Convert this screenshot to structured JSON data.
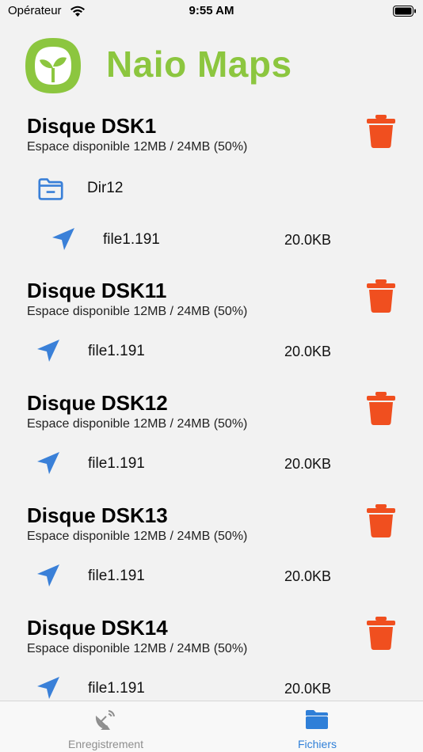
{
  "status": {
    "carrier": "Opérateur",
    "time": "9:55 AM"
  },
  "header": {
    "title": "Naio Maps"
  },
  "colors": {
    "accent": "#8cc63f",
    "delete": "#f04f1f",
    "blue": "#3a80d8"
  },
  "disks": [
    {
      "name": "Disque DSK1",
      "space": "Espace disponible 12MB / 24MB (50%)",
      "folder": {
        "name": "Dir12",
        "icon": "folder-icon"
      },
      "files": [
        {
          "name": "file1.191",
          "size": "20.0KB",
          "icon": "send-icon"
        }
      ]
    },
    {
      "name": "Disque DSK11",
      "space": "Espace disponible 12MB / 24MB (50%)",
      "files": [
        {
          "name": "file1.191",
          "size": "20.0KB",
          "icon": "send-icon"
        }
      ]
    },
    {
      "name": "Disque DSK12",
      "space": "Espace disponible 12MB / 24MB (50%)",
      "files": [
        {
          "name": "file1.191",
          "size": "20.0KB",
          "icon": "send-icon"
        }
      ]
    },
    {
      "name": "Disque DSK13",
      "space": "Espace disponible 12MB / 24MB (50%)",
      "files": [
        {
          "name": "file1.191",
          "size": "20.0KB",
          "icon": "send-icon"
        }
      ]
    },
    {
      "name": "Disque DSK14",
      "space": "Espace disponible 12MB / 24MB (50%)",
      "files": [
        {
          "name": "file1.191",
          "size": "20.0KB",
          "icon": "send-icon"
        }
      ]
    }
  ],
  "tabs": [
    {
      "label": "Enregistrement",
      "icon": "satellite-dish-icon",
      "selected": false
    },
    {
      "label": "Fichiers",
      "icon": "folder-icon",
      "selected": true
    }
  ]
}
